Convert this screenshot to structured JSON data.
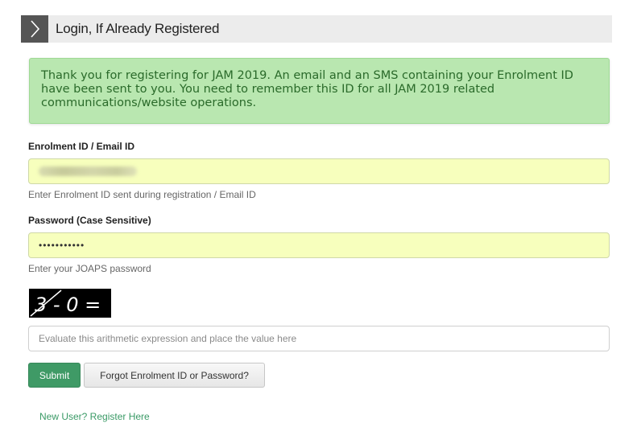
{
  "header": {
    "title": "Login, If Already Registered",
    "arrow_icon": "chevron-right-icon"
  },
  "alert": {
    "message": "Thank you for registering for JAM 2019. An email and an SMS containing your Enrolment ID have been sent to you. You need to remember this ID for all JAM 2019 related communications/website operations."
  },
  "enrolment": {
    "label": "Enrolment ID / Email ID",
    "value": "",
    "help": "Enter Enrolment ID sent during registration / Email ID"
  },
  "password": {
    "label": "Password (Case Sensitive)",
    "value": "•••••••••••",
    "help": "Enter your JOAPS password"
  },
  "captcha": {
    "expression": "3 - 0 ="
  },
  "answer": {
    "placeholder": "Evaluate this arithmetic expression and place the value here",
    "value": ""
  },
  "buttons": {
    "submit": "Submit",
    "forgot": "Forgot Enrolment ID or Password?"
  },
  "links": {
    "register": "New User? Register Here"
  },
  "colors": {
    "accent": "#3f9a66",
    "alert_bg": "#b9e7b0",
    "alert_text": "#2a6a2a",
    "field_bg": "#f7ffbd"
  }
}
